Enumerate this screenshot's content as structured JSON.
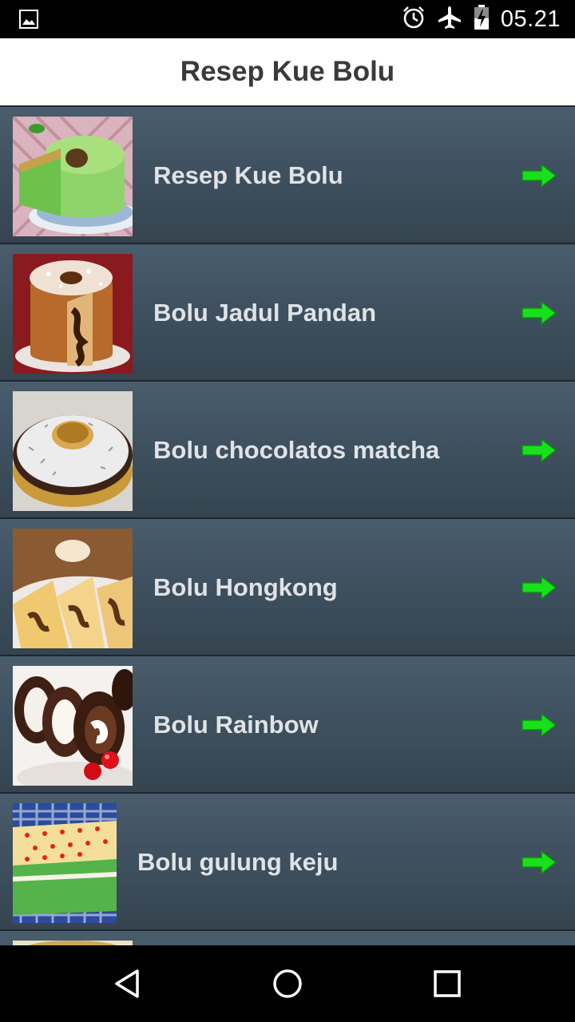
{
  "status_bar": {
    "time": "05.21",
    "icons": [
      "image-notification-icon",
      "alarm-icon",
      "airplane-mode-icon",
      "battery-charging-icon"
    ]
  },
  "header": {
    "title": "Resep Kue Bolu"
  },
  "list": {
    "items": [
      {
        "label": "Resep Kue Bolu",
        "thumb": "green-pandan-bundt-cake"
      },
      {
        "label": "Bolu Jadul Pandan",
        "thumb": "marble-bundt-cake"
      },
      {
        "label": "Bolu chocolatos matcha",
        "thumb": "coconut-chocolate-bundt-cake"
      },
      {
        "label": "Bolu Hongkong",
        "thumb": "sliced-marble-cake"
      },
      {
        "label": "Bolu Rainbow",
        "thumb": "chocolate-roll-cake"
      },
      {
        "label": "Bolu gulung keju",
        "thumb": "green-layer-cake-cheese"
      }
    ],
    "arrow_color": "#19e01c"
  },
  "nav_bar": {
    "buttons": [
      "back-icon",
      "home-icon",
      "recents-icon"
    ]
  }
}
